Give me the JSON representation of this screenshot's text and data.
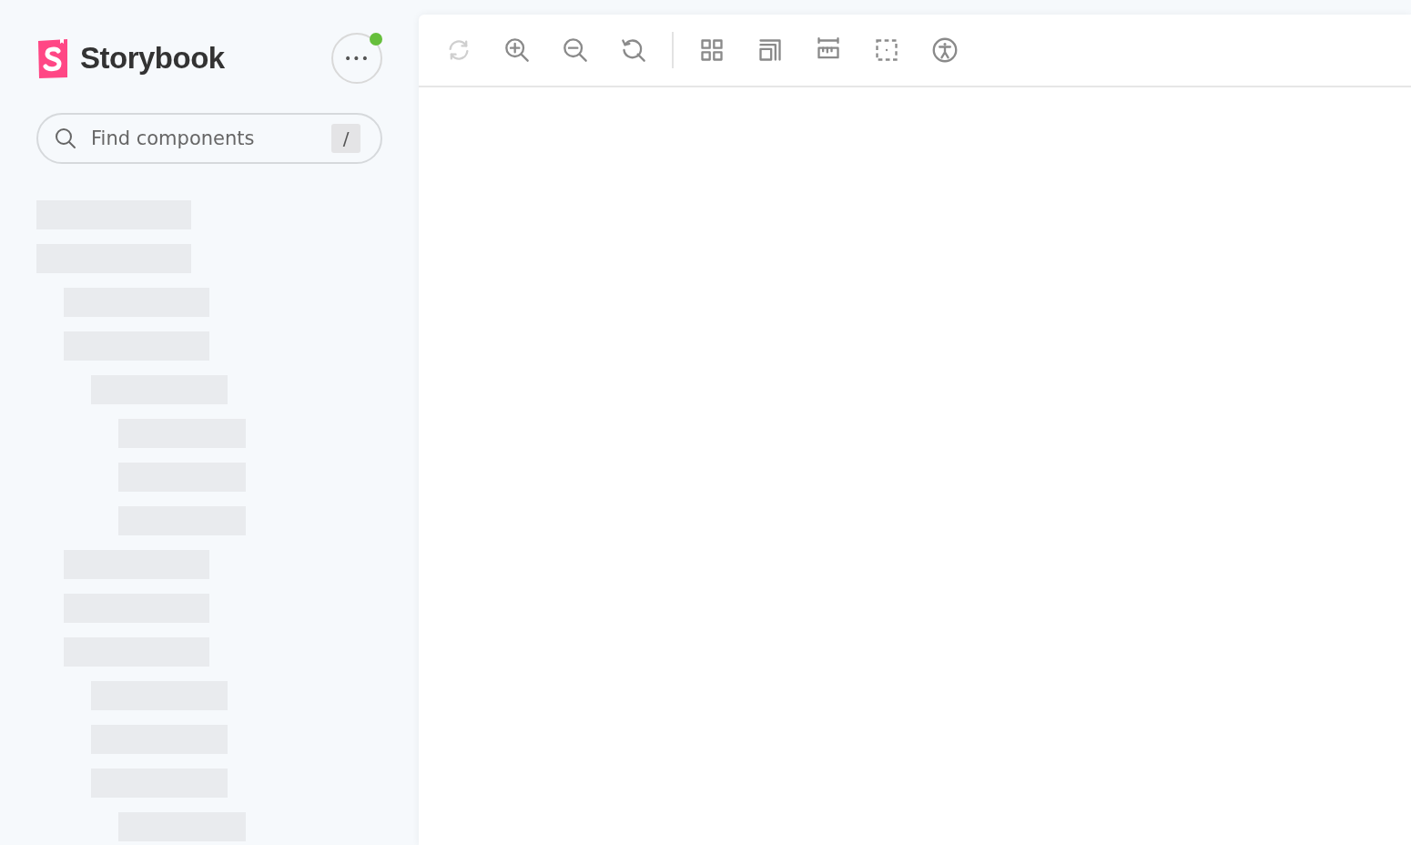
{
  "sidebar": {
    "brand": "Storybook",
    "menu": {
      "label": "•••",
      "color": "#66bf3c"
    },
    "search": {
      "placeholder": "Find components",
      "shortcut": "/"
    },
    "tree": [
      {
        "kind": "skeleton"
      },
      {
        "kind": "skeleton",
        "children": [
          {
            "kind": "skeleton"
          },
          {
            "kind": "skeleton",
            "children": [
              {
                "kind": "skeleton",
                "children": [
                  {
                    "kind": "skeleton"
                  },
                  {
                    "kind": "skeleton"
                  },
                  {
                    "kind": "skeleton"
                  }
                ]
              }
            ]
          },
          {
            "kind": "skeleton"
          },
          {
            "kind": "skeleton"
          },
          {
            "kind": "skeleton",
            "children": [
              {
                "kind": "skeleton"
              },
              {
                "kind": "skeleton"
              },
              {
                "kind": "skeleton",
                "children": [
                  {
                    "kind": "skeleton"
                  }
                ]
              }
            ]
          }
        ]
      }
    ]
  },
  "toolbar": [
    {
      "kind": "sync",
      "disabled": true
    },
    {
      "kind": "zoom-in",
      "disabled": false
    },
    {
      "kind": "zoom-out",
      "disabled": false
    },
    {
      "kind": "zoom-reset",
      "disabled": false
    },
    {
      "kind": "separator"
    },
    {
      "kind": "grid",
      "disabled": false
    },
    {
      "kind": "background",
      "disabled": false
    },
    {
      "kind": "measure",
      "disabled": false
    },
    {
      "kind": "outline",
      "disabled": false
    },
    {
      "kind": "accessibility",
      "disabled": false
    }
  ]
}
